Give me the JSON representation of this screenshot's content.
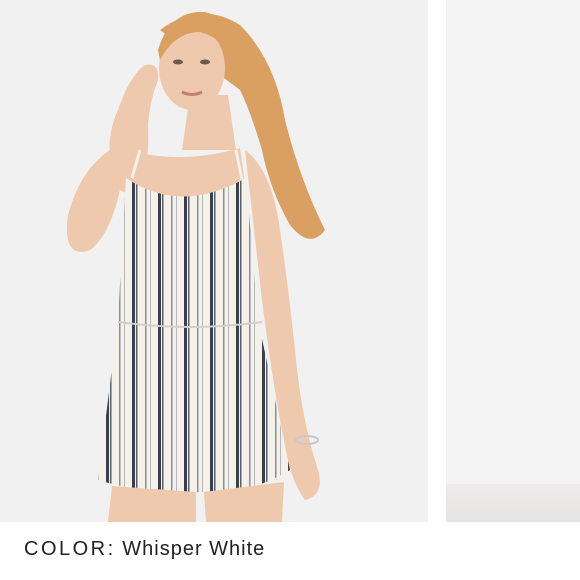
{
  "product": {
    "color_label": "COLOR:",
    "color_name": "Whisper White"
  },
  "images": {
    "main": "model-in-striped-romper",
    "next": "partial-next-product-image"
  },
  "colors": {
    "background": "#f1f1f2",
    "stripe": "#3a3f4a",
    "fabric": "#f4f1ea",
    "hair": "#d9a062",
    "skin": "#efc9ad",
    "text": "#222222"
  }
}
